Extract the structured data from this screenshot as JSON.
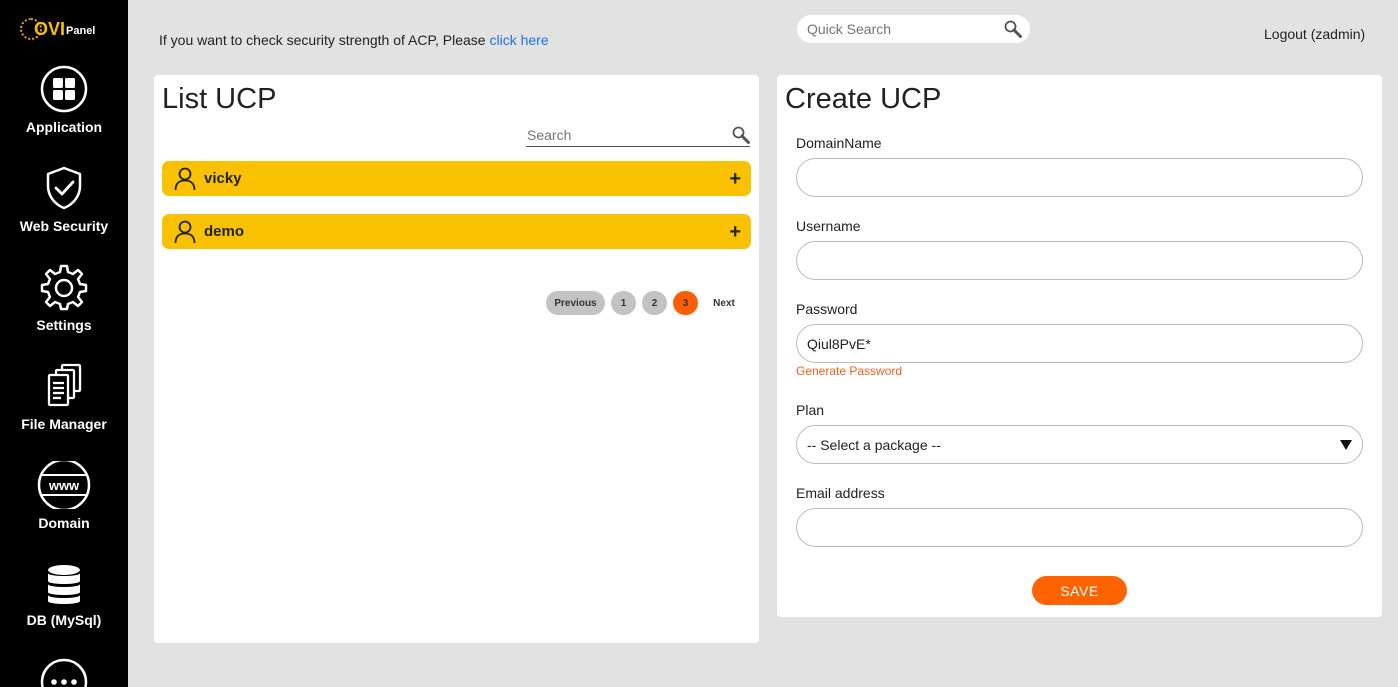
{
  "sidebar": {
    "logo": {
      "ovi": "OVI",
      "panel": "Panel"
    },
    "items": [
      {
        "label": "Application",
        "icon": "grid-icon"
      },
      {
        "label": "Web Security",
        "icon": "shield-check-icon"
      },
      {
        "label": "Settings",
        "icon": "gear-icon"
      },
      {
        "label": "File Manager",
        "icon": "documents-icon"
      },
      {
        "label": "Domain",
        "icon": "www-icon"
      },
      {
        "label": "DB (MySql)",
        "icon": "database-icon"
      },
      {
        "label": "",
        "icon": "more-icon"
      }
    ]
  },
  "header": {
    "notice_text": "If you want to check security strength of ACP, Please ",
    "notice_link": "click here",
    "quick_search_placeholder": "Quick Search",
    "logout": "Logout (zadmin)"
  },
  "list_panel": {
    "title": "List UCP",
    "search_placeholder": "Search",
    "users": [
      {
        "name": "vicky",
        "action": "+"
      },
      {
        "name": "demo",
        "action": "+"
      }
    ],
    "pagination": {
      "previous": "Previous",
      "pages": [
        "1",
        "2",
        "3"
      ],
      "current": "3",
      "next": "Next"
    }
  },
  "create_panel": {
    "title": "Create UCP",
    "fields": {
      "domain_label": "DomainName",
      "domain_value": "",
      "username_label": "Username",
      "username_value": "",
      "password_label": "Password",
      "password_value": "Qiul8PvE*",
      "generate_password": "Generate Password",
      "plan_label": "Plan",
      "plan_selected": "-- Select a package --",
      "email_label": "Email address",
      "email_value": ""
    },
    "save": "SAVE"
  },
  "colors": {
    "accent_orange": "#ff6300",
    "row_yellow": "#f9c100",
    "link_blue": "#1a73e8",
    "sidebar_bg": "#000000"
  }
}
